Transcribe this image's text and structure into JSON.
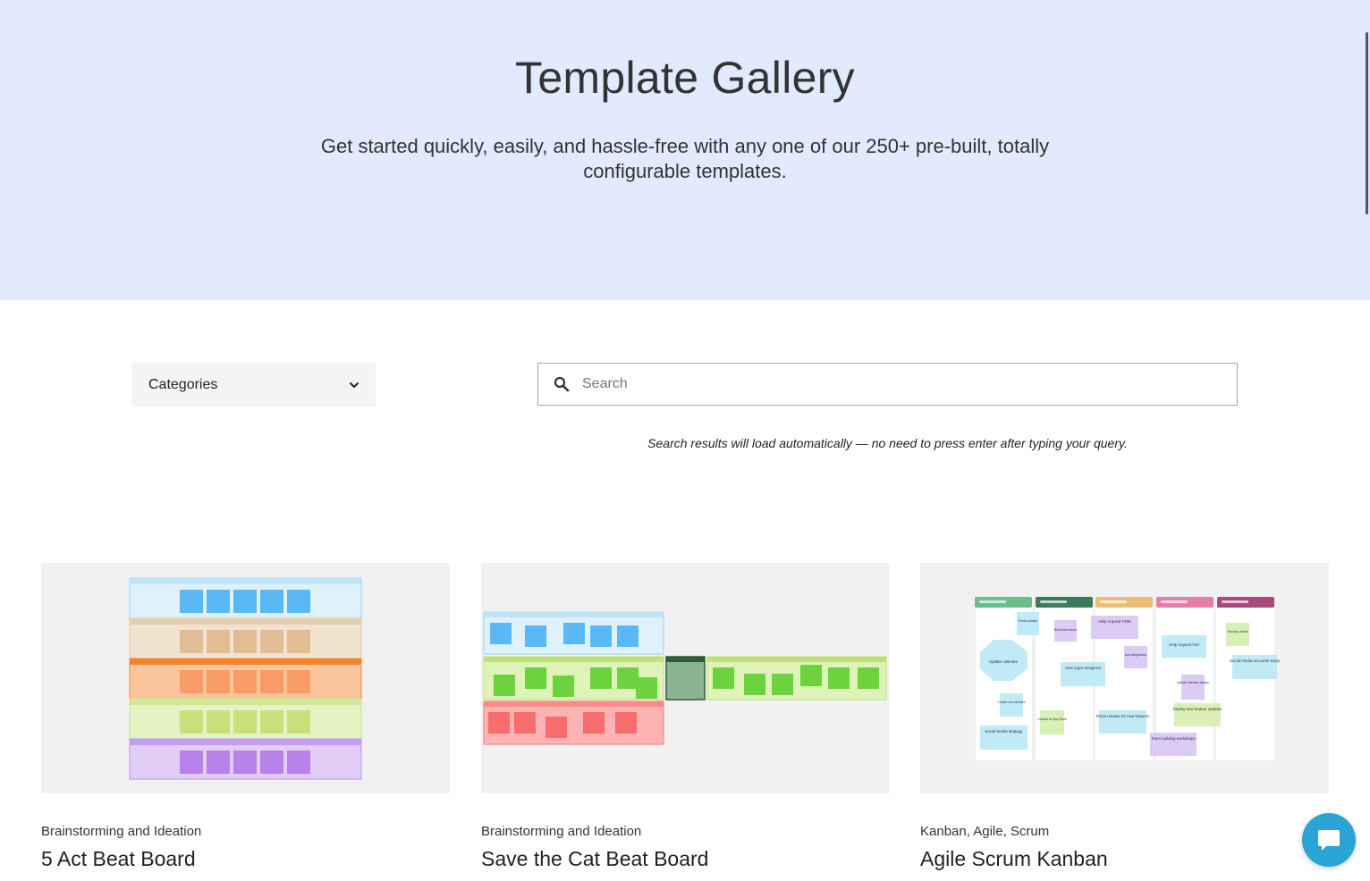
{
  "hero": {
    "title": "Template Gallery",
    "subtitle": "Get started quickly, easily, and hassle-free with any one of our 250+ pre-built, totally configurable templates."
  },
  "filters": {
    "categories_label": "Categories",
    "search_placeholder": "Search",
    "search_value": "",
    "search_hint": "Search results will load automatically — no need to press enter after typing your query."
  },
  "cards": [
    {
      "category": "Brainstorming and Ideation",
      "title": "5 Act Beat Board"
    },
    {
      "category": "Brainstorming and Ideation",
      "title": "Save the Cat Beat Board"
    },
    {
      "category": "Kanban, Agile, Scrum",
      "title": "Agile Scrum Kanban"
    }
  ],
  "kanban_notes": [
    "Email updates",
    "Build new server",
    "Help request #456",
    "App integrations",
    "Update calendar",
    "New logos designed",
    "Help request #43",
    "Security review",
    "Social media accounts setup",
    "Create new interface",
    "Update interface design",
    "Content for App Store",
    "Press release for new features",
    "Deploy new feature updates",
    "Social media strategy",
    "Team building workshops"
  ],
  "colors": {
    "hero_bg": "#e1ebfd",
    "chat_button": "#2aa3d5"
  },
  "icons": {
    "search": "search-icon",
    "dropdown": "chevron-down-icon",
    "chat": "chat-bubble-icon"
  }
}
